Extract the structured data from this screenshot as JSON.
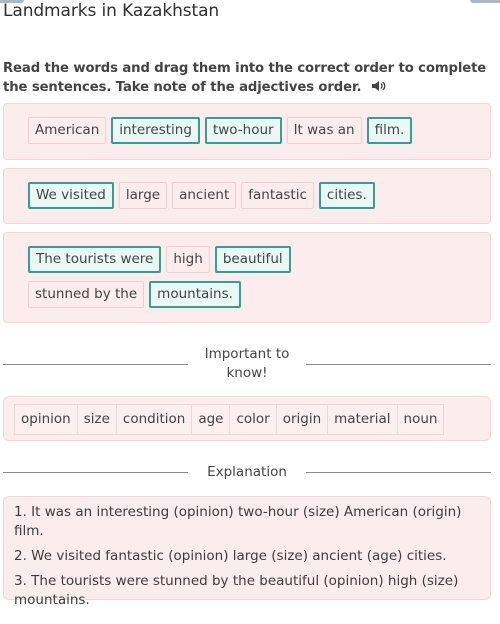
{
  "header": {
    "title": "Landmarks in Kazakhstan"
  },
  "instructions": {
    "text": "Read the words and drag them into the correct order to complete the sentences. Take note of the adjectives order.",
    "audio_icon": "speaker-icon"
  },
  "colors": {
    "box_bg": "#fbecee",
    "box_border": "#f3d6da",
    "chip_correct_border": "#3d9c8e",
    "chip_correct_bg": "#e9f8f5",
    "chip_incorrect_border": "#f3ccd1"
  },
  "sentences": [
    {
      "chips": [
        {
          "text": "American",
          "state": "pink"
        },
        {
          "text": "interesting",
          "state": "teal"
        },
        {
          "text": "two-hour",
          "state": "teal"
        },
        {
          "text": "It was an",
          "state": "pink"
        },
        {
          "text": "film.",
          "state": "teal"
        }
      ]
    },
    {
      "chips": [
        {
          "text": "We visited",
          "state": "teal"
        },
        {
          "text": "large",
          "state": "pink"
        },
        {
          "text": "ancient",
          "state": "pink"
        },
        {
          "text": "fantastic",
          "state": "pink"
        },
        {
          "text": "cities.",
          "state": "teal"
        }
      ]
    },
    {
      "chips": [
        {
          "text": "The tourists were",
          "state": "teal"
        },
        {
          "text": "high",
          "state": "pink"
        },
        {
          "text": "beautiful",
          "state": "teal"
        },
        {
          "text": "stunned by the",
          "state": "pink"
        },
        {
          "text": "mountains.",
          "state": "teal"
        }
      ]
    }
  ],
  "important": {
    "label_line1": "Important to",
    "label_line2": "know!",
    "adjective_order": [
      "opinion",
      "size",
      "condition",
      "age",
      "color",
      "origin",
      "material",
      "noun"
    ]
  },
  "explanation": {
    "label": "Explanation",
    "lines": [
      "1. It was an interesting (opinion) two-hour (size) American (origin) film.",
      "2. We visited fantastic (opinion) large (size) ancient (age) cities.",
      "3. The tourists were stunned by the beautiful (opinion) high (size) mountains."
    ]
  }
}
